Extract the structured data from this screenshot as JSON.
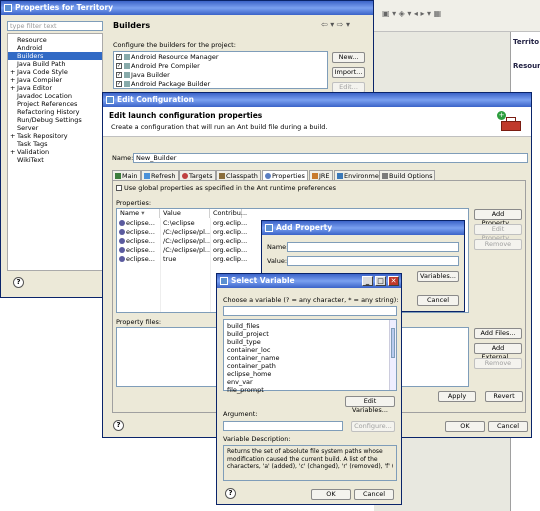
{
  "props_window": {
    "title": "Properties for Territory",
    "filter_placeholder": "type filter text",
    "tree": [
      {
        "label": "Resource",
        "exp": ""
      },
      {
        "label": "Android",
        "exp": ""
      },
      {
        "label": "Builders",
        "exp": "",
        "selected": true
      },
      {
        "label": "Java Build Path",
        "exp": ""
      },
      {
        "label": "Java Code Style",
        "exp": "+"
      },
      {
        "label": "Java Compiler",
        "exp": "+"
      },
      {
        "label": "Java Editor",
        "exp": "+"
      },
      {
        "label": "Javadoc Location",
        "exp": ""
      },
      {
        "label": "Project References",
        "exp": ""
      },
      {
        "label": "Refactoring History",
        "exp": ""
      },
      {
        "label": "Run/Debug Settings",
        "exp": ""
      },
      {
        "label": "Server",
        "exp": ""
      },
      {
        "label": "Task Repository",
        "exp": "+"
      },
      {
        "label": "Task Tags",
        "exp": ""
      },
      {
        "label": "Validation",
        "exp": "+"
      },
      {
        "label": "WikiText",
        "exp": ""
      }
    ],
    "section_title": "Builders",
    "configure_label": "Configure the builders for the project:",
    "builders": [
      "Android Resource Manager",
      "Android Pre Compiler",
      "Java Builder",
      "Android Package Builder"
    ],
    "new_btn": "New...",
    "import_btn": "Import...",
    "edit_btn": "Edit..."
  },
  "right_panel": {
    "tab1": "Territo",
    "tab2": "Resour"
  },
  "edit_config": {
    "title": "Edit Configuration",
    "heading": "Edit launch configuration properties",
    "subheading": "Create a configuration that will run an Ant build file during a build.",
    "name_label": "Name:",
    "name_value": "New_Builder",
    "tabs": [
      "Main",
      "Refresh",
      "Targets",
      "Classpath",
      "Properties",
      "JRE",
      "Environment",
      "Build Options"
    ],
    "active_tab": "Properties",
    "use_global_label": "Use global properties as specified in the Ant runtime preferences",
    "properties_label": "Properties:",
    "col_name": "Name",
    "col_value": "Value",
    "col_contrib": "Contribu...",
    "prop_rows": [
      {
        "name": "eclipse...",
        "value": "C:\\eclipse",
        "contrib": "org.eclip..."
      },
      {
        "name": "eclipse...",
        "value": "/C:/eclipse/pl...",
        "contrib": "org.eclip..."
      },
      {
        "name": "eclipse...",
        "value": "/C:/eclipse/pl...",
        "contrib": "org.eclip..."
      },
      {
        "name": "eclipse...",
        "value": "/C:/eclipse/pl...",
        "contrib": "org.eclip..."
      },
      {
        "name": "eclipse...",
        "value": "true",
        "contrib": "org.eclip..."
      }
    ],
    "add_property_btn": "Add Property...",
    "edit_property_btn": "Edit Property...",
    "remove_btn": "Remove",
    "property_files_label": "Property files:",
    "add_files_btn": "Add Files...",
    "add_external_btn": "Add External...",
    "remove2_btn": "Remove",
    "apply_btn": "Apply",
    "revert_btn": "Revert",
    "ok_btn": "OK",
    "cancel_btn": "Cancel"
  },
  "add_property": {
    "title": "Add Property",
    "name_label": "Name:",
    "value_label": "Value:",
    "variables_btn": "Variables...",
    "cancel_btn": "Cancel"
  },
  "select_variable": {
    "title": "Select Variable",
    "choose_label": "Choose a variable (? = any character, * = any string):",
    "variables": [
      "build_files",
      "build_project",
      "build_type",
      "container_loc",
      "container_name",
      "container_path",
      "eclipse_home",
      "env_var",
      "file_prompt"
    ],
    "edit_variables_btn": "Edit Variables...",
    "argument_label": "Argument:",
    "configure_btn": "Configure...",
    "description_label": "Variable Description:",
    "description_lines": [
      "Returns the set of absolute file system paths whose",
      "modification caused the current build.  A list of the",
      "characters, 'a' (added), 'c' (changed), 'r' (removed), 'f' (files"
    ],
    "ok_btn": "OK",
    "cancel_btn": "Cancel"
  }
}
